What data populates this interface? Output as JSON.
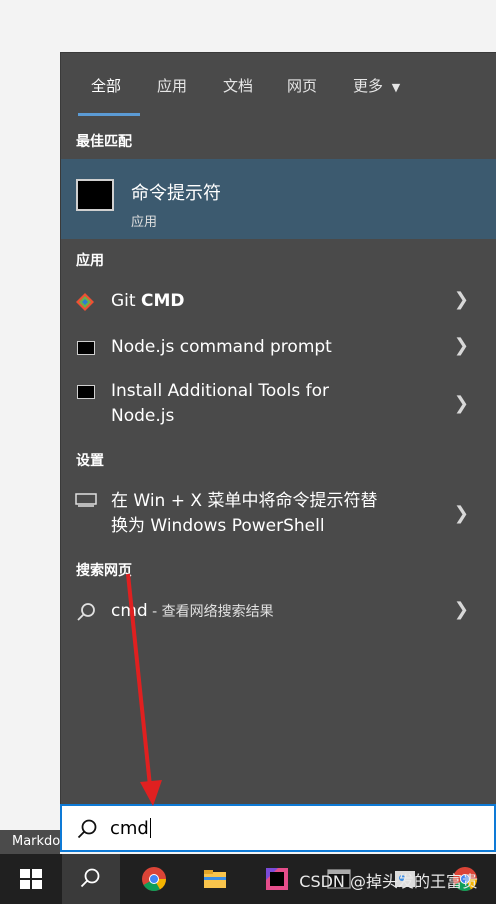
{
  "tabs": [
    "全部",
    "应用",
    "文档",
    "网页",
    "更多"
  ],
  "sections": {
    "best": "最佳匹配",
    "apps": "应用",
    "settings": "设置",
    "web": "搜索网页"
  },
  "best_match": {
    "name": "命令提示符",
    "sub": "应用"
  },
  "apps": [
    {
      "name": "Git ",
      "bold": "CMD"
    },
    {
      "name": "Node.js command prompt"
    },
    {
      "line1": "Install Additional Tools for",
      "line2": "Node.js"
    }
  ],
  "setting": {
    "line1": "在 Win + X 菜单中将命令提示符替",
    "line2": "换为 Windows PowerShell"
  },
  "web": {
    "query": "cmd",
    "hint": " - 查看网络搜索结果"
  },
  "search": {
    "value": "cmd"
  },
  "markdown_label": "Markdo",
  "watermark": "CSDN @掉头发的王富贵",
  "colors": {
    "accent": "#0e7ad6",
    "highlight": "#3c5a6f",
    "panel": "#4a4a4a",
    "arrow": "#e02020"
  }
}
